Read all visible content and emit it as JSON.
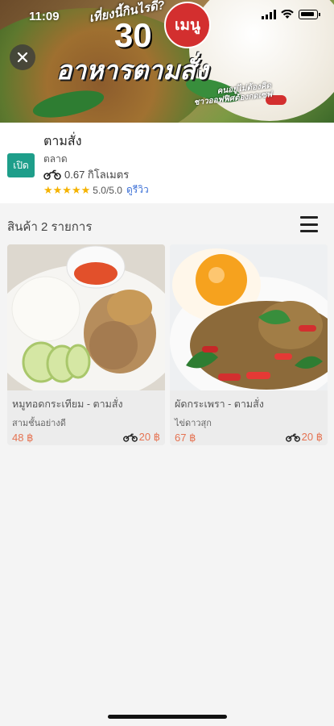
{
  "status": {
    "time": "11:09"
  },
  "banner": {
    "tag": "เที่ยงนี้กินไรดี?",
    "number": "30",
    "badge": "เมนู",
    "title": "อาหารตามสั่ง",
    "subtitle_line1": "คนอยู่ไม่ต้องคิด",
    "subtitle_line2": "ชาวออฟฟิศต้องกดเซฟ"
  },
  "shop": {
    "status_badge": "เปิด",
    "name": "ตามสั่ง",
    "category": "ตลาด",
    "distance": "0.67 กิโลเมตร",
    "rating_text": "5.0/5.0",
    "review_link": "ดูรีวิว",
    "stars": "★★★★★"
  },
  "products": {
    "count_label": "สินค้า 2 รายการ",
    "items": [
      {
        "name": "หมูทอดกระเทียม - ตามสั่ง",
        "desc": "สามชั้นอย่างดี",
        "price": "48 ฿",
        "shipping": "20 ฿"
      },
      {
        "name": "ผัดกระเพรา - ตามสั่ง",
        "desc": "ไข่ดาวสุก",
        "price": "67 ฿",
        "shipping": "20 ฿"
      }
    ]
  },
  "colors": {
    "open_badge": "#1e9e8a",
    "price": "#e57352",
    "star": "#f5b301",
    "link": "#3b6fd6"
  },
  "icons": {
    "close": "close-icon",
    "motorcycle": "motorcycle-icon",
    "menu": "hamburger-menu-icon"
  }
}
